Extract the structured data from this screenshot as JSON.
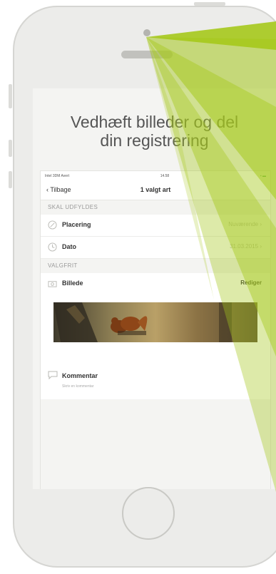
{
  "headline": {
    "line1": "Vedhæft billeder og del",
    "line2": "din registrering"
  },
  "status_bar": {
    "carrier": "Intel 3DM Avert",
    "time": "14.58",
    "battery": "▪ ▬"
  },
  "navbar": {
    "back_label": "Tilbage",
    "title": "1 valgt art"
  },
  "sections": {
    "required": {
      "header": "SKAL UDFYLDES"
    },
    "optional": {
      "header": "VALGFRIT"
    }
  },
  "rows": {
    "placering": {
      "label": "Placering",
      "value": "Nuværende",
      "icon": "location-icon"
    },
    "dato": {
      "label": "Dato",
      "value": "31.03.2015",
      "icon": "clock-icon"
    },
    "billede": {
      "label": "Billede",
      "action": "Rediger",
      "icon": "camera-icon"
    },
    "kommentar": {
      "label": "Kommentar",
      "placeholder": "Skriv en kommentar",
      "icon": "comment-icon"
    }
  },
  "colors": {
    "accent_green": "#a6c91c",
    "background": "#ececea"
  }
}
